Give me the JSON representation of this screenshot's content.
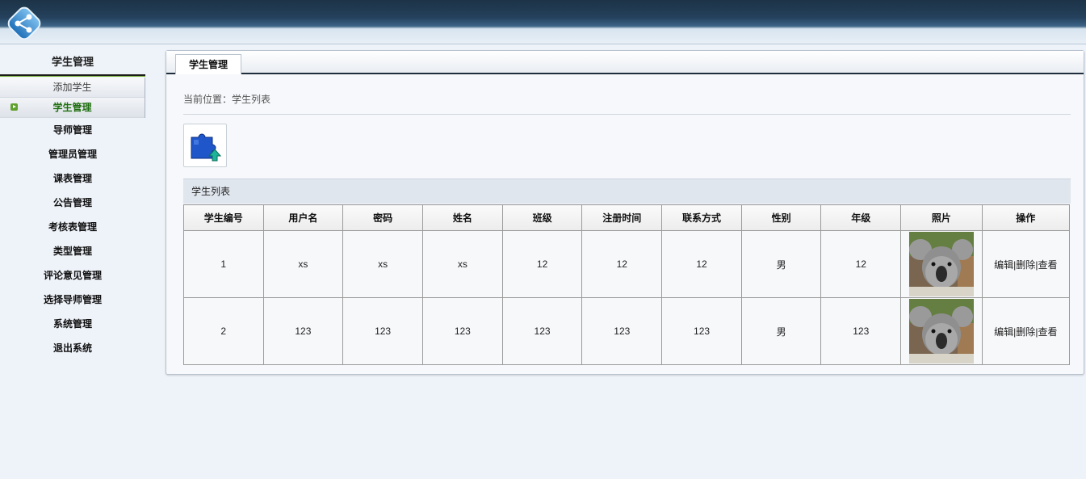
{
  "sidebar": {
    "section_title": "学生管理",
    "sub_items": [
      {
        "label": "添加学生",
        "active": false
      },
      {
        "label": "学生管理",
        "active": true
      }
    ],
    "menu": [
      "导师管理",
      "管理员管理",
      "课表管理",
      "公告管理",
      "考核表管理",
      "类型管理",
      "评论意见管理",
      "选择导师管理",
      "系统管理",
      "退出系统"
    ]
  },
  "main": {
    "tab": "学生管理",
    "breadcrumb": "当前位置：学生列表",
    "list_title": "学生列表",
    "table": {
      "columns": [
        "学生编号",
        "用户名",
        "密码",
        "姓名",
        "班级",
        "注册时间",
        "联系方式",
        "性别",
        "年级",
        "照片",
        "操作"
      ],
      "rows": [
        [
          "1",
          "xs",
          "xs",
          "xs",
          "12",
          "12",
          "12",
          "男",
          "12"
        ],
        [
          "2",
          "123",
          "123",
          "123",
          "123",
          "123",
          "123",
          "男",
          "123"
        ]
      ],
      "actions": {
        "edit": "编辑",
        "delete": "删除",
        "view": "查看",
        "sep": "|"
      }
    }
  },
  "colors": {
    "accent_green": "#1f6e10",
    "header_dark": "#1d3347"
  },
  "icons": {
    "logo": "share-network-logo",
    "tool": "puzzle-upload-icon",
    "nav": "arrow-right-icon",
    "photo": "koala-photo"
  }
}
